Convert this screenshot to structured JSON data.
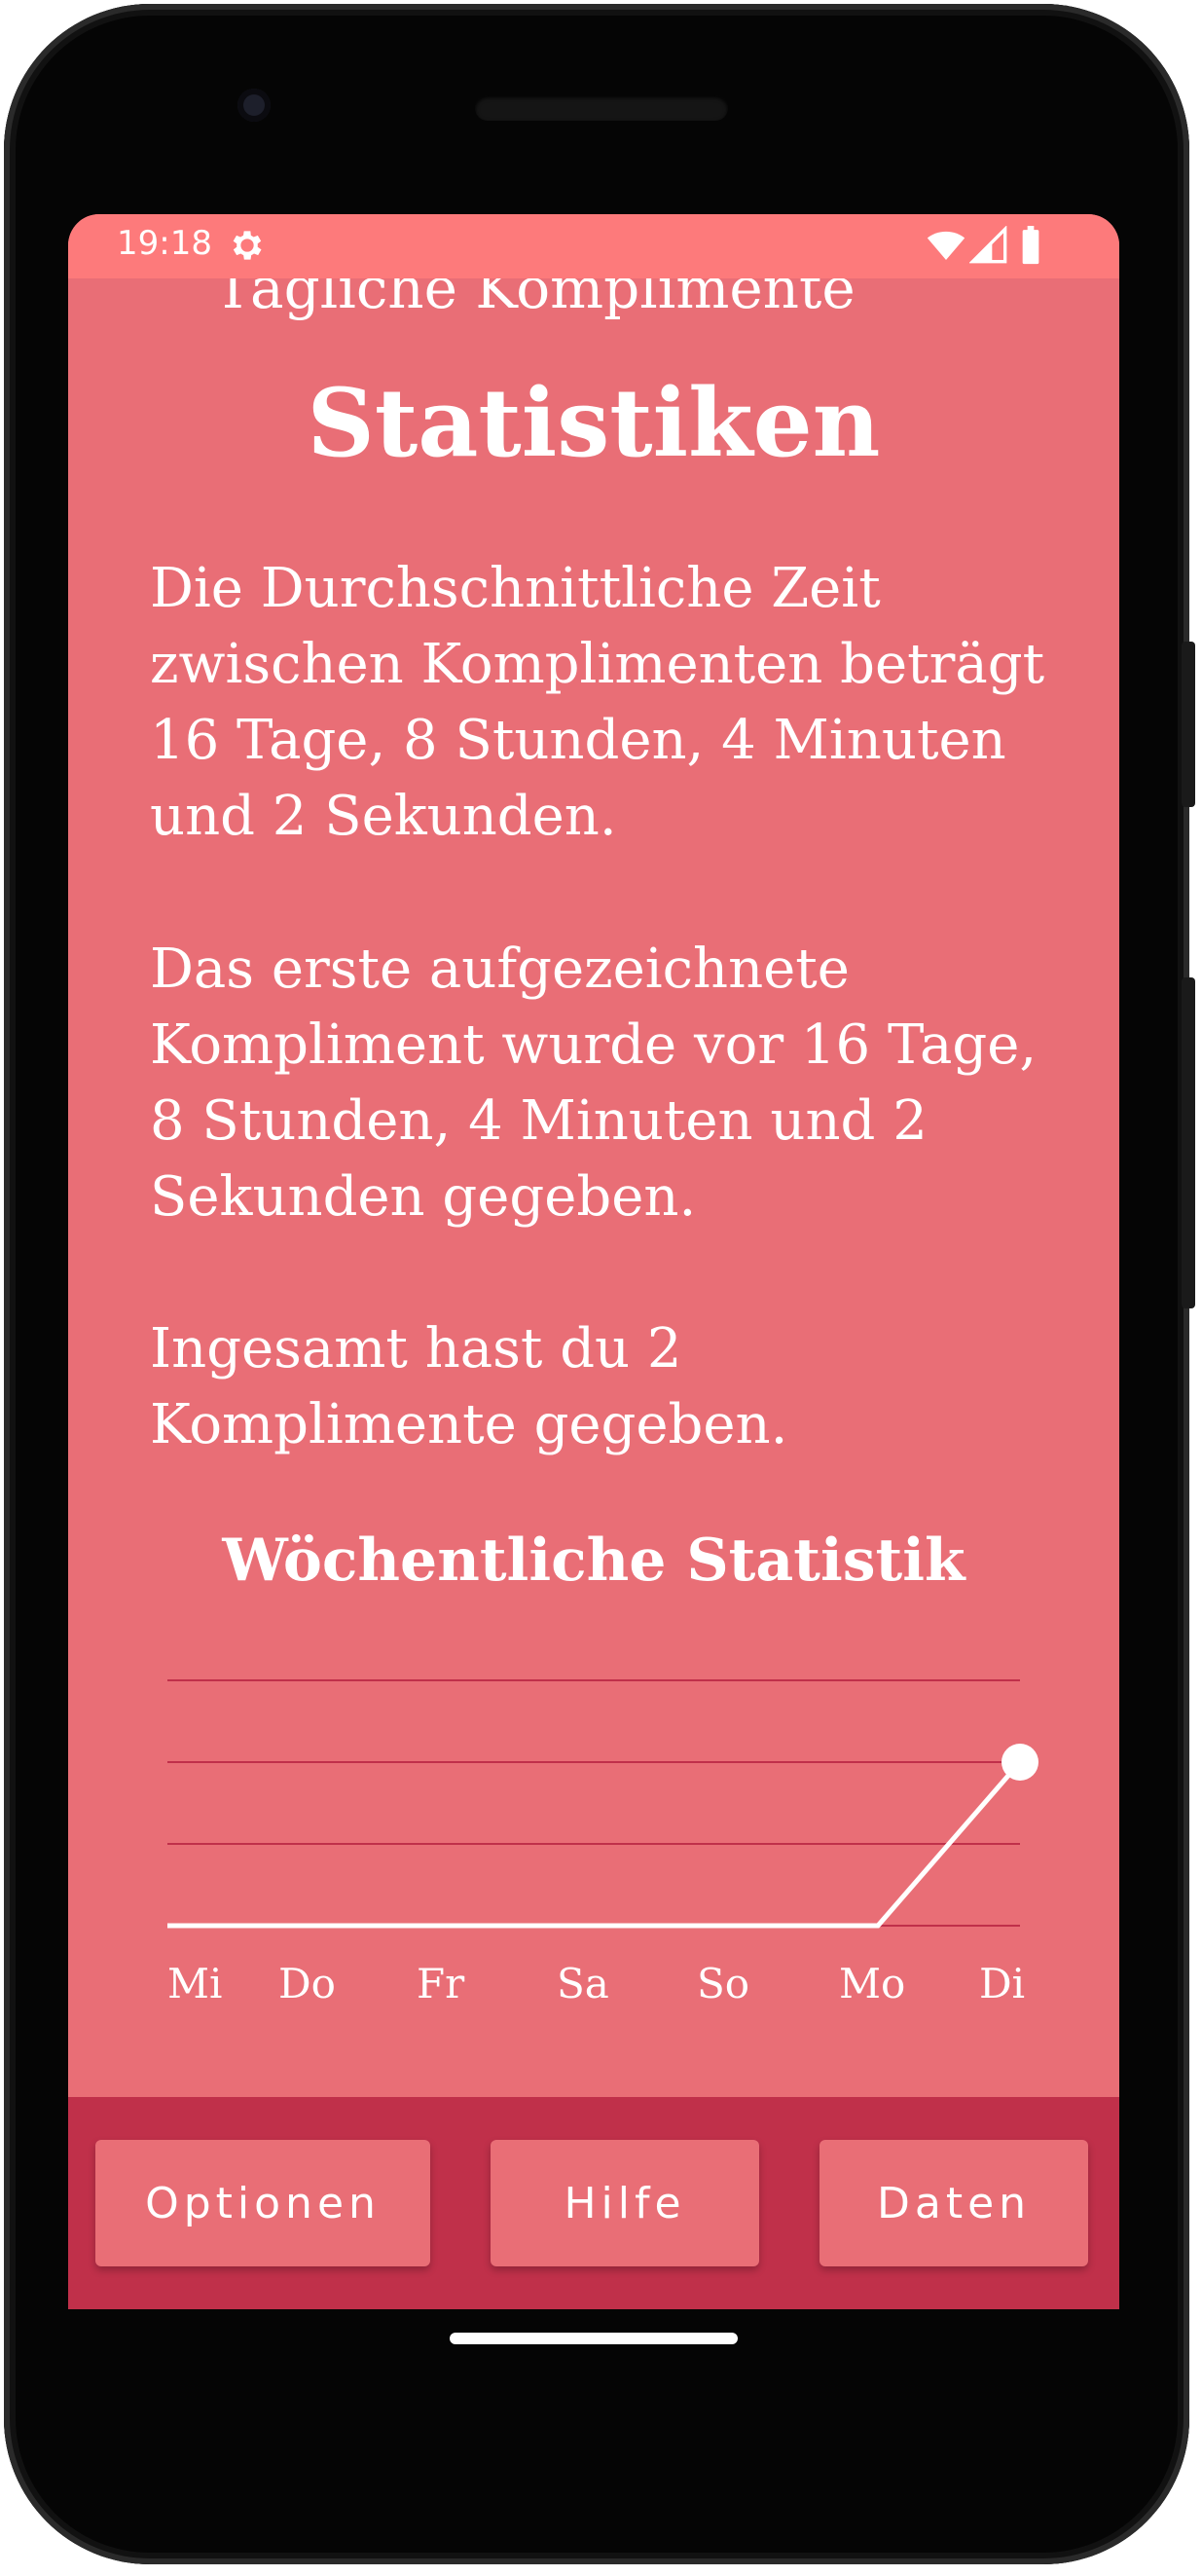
{
  "status_bar": {
    "time": "19:18",
    "icons": [
      "gear-icon",
      "wifi-icon",
      "signal-icon",
      "battery-icon"
    ]
  },
  "header": {
    "clipped_heading": "Tägliche Komplimente",
    "title": "Statistiken"
  },
  "stats": {
    "average_interval": "Die Durchschnittliche Zeit zwischen Komplimenten beträgt 16 Tage, 8 Stunden, 4 Minuten und 2 Sekunden.",
    "first_recorded": "Das erste aufgezeichnete Kompliment wurde vor 16 Tage, 8 Stunden, 4 Minuten und 2 Sekunden gegeben.",
    "total": "Ingesamt hast du 2 Komplimente gegeben."
  },
  "weekly_chart": {
    "title": "Wöchentliche Statistik"
  },
  "chart_data": {
    "type": "line",
    "title": "Wöchentliche Statistik",
    "categories": [
      "Mi",
      "Do",
      "Fr",
      "Sa",
      "So",
      "Mo",
      "Di"
    ],
    "values": [
      0,
      0,
      0,
      0,
      0,
      0,
      2
    ],
    "ylim": [
      0,
      3
    ],
    "grid": true,
    "colors": {
      "line": "#ffffff",
      "grid": "#c0304a"
    }
  },
  "nav": {
    "options_label": "Optionen",
    "help_label": "Hilfe",
    "data_label": "Daten"
  },
  "colors": {
    "background": "#e96e76",
    "status_bar": "#fd7a7b",
    "nav_bar": "#c0304a",
    "text": "#ffffff"
  }
}
